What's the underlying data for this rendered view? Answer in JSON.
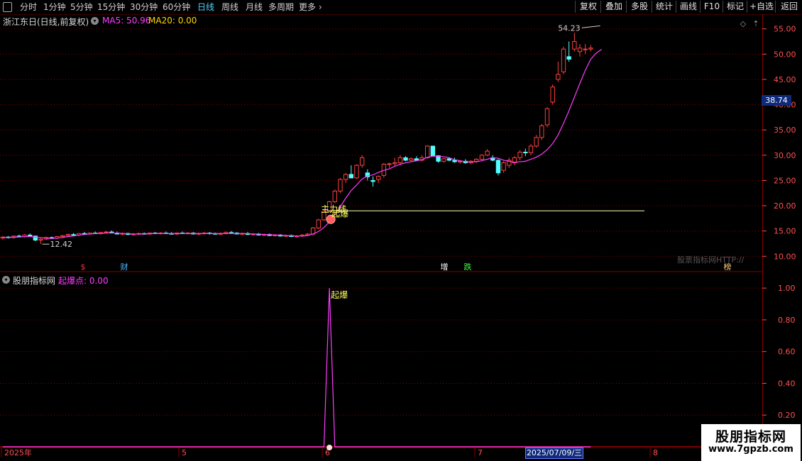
{
  "toolbar": {
    "left": [
      {
        "label": "分时",
        "active": false
      },
      {
        "label": "1分钟",
        "active": false
      },
      {
        "label": "5分钟",
        "active": false
      },
      {
        "label": "15分钟",
        "active": false
      },
      {
        "label": "30分钟",
        "active": false
      },
      {
        "label": "60分钟",
        "active": false
      },
      {
        "label": "日线",
        "active": true
      },
      {
        "label": "周线",
        "active": false
      },
      {
        "label": "月线",
        "active": false
      },
      {
        "label": "多周期",
        "active": false
      },
      {
        "label": "更多",
        "active": false
      }
    ],
    "more_arrow": "›",
    "right": [
      "复权",
      "叠加",
      "多股",
      "统计",
      "画线",
      "F10",
      "标记",
      "+自选",
      "返回"
    ]
  },
  "header": {
    "stock_name": "浙江东日(日线,前复权)",
    "ma5": "MA5: 50.96",
    "ma20": "MA20: 0.00"
  },
  "subchart": {
    "name": "股朋指标网",
    "value": "起爆点: 0.00"
  },
  "price_axis": [
    "55.00",
    "50.00",
    "45.00",
    "40.00",
    "35.00",
    "30.00",
    "25.00",
    "20.00",
    "15.00",
    "10.00"
  ],
  "price_tag": "38.74",
  "sub_axis": [
    "1.00",
    "0.80",
    "0.60",
    "0.40",
    "0.20"
  ],
  "date_axis": [
    "2025年",
    "5",
    "6",
    "7",
    "8"
  ],
  "date_tag": "2025/07/09/三",
  "annotations": {
    "high_label": "54.23",
    "low_label": "12.42",
    "signal_line_label": "主力线",
    "signal_marker_label": "起爆",
    "sub_peak_label": "起爆"
  },
  "event_markers": [
    {
      "label": "$",
      "color": "#ff3030"
    },
    {
      "label": "财",
      "color": "#4fb8ff"
    },
    {
      "label": "增",
      "color": "#ffffff"
    },
    {
      "label": "跌",
      "color": "#40ff40"
    },
    {
      "label": "榜",
      "color": "#ffd080"
    }
  ],
  "watermark": "股票指标网HTTP://",
  "brand": {
    "title": "股朋指标网",
    "url": "www.7gpzb.com"
  },
  "colors": {
    "up": "#ff4040",
    "down": "#54ffff",
    "ma5": "#ff3cff",
    "ma20": "#ffd800",
    "grid": "#8a0000",
    "axis_text": "#ff5050",
    "signal_line": "#ffffb0"
  },
  "chart_data": {
    "type": "candlestick",
    "price_range": [
      8.5,
      56.5
    ],
    "sub_range": [
      0,
      1.05
    ],
    "sessions": 140,
    "candles": [
      {
        "o": 13.6,
        "h": 14.0,
        "l": 13.3,
        "c": 13.8
      },
      {
        "o": 13.8,
        "h": 14.0,
        "l": 13.5,
        "c": 13.7
      },
      {
        "o": 13.7,
        "h": 14.1,
        "l": 13.5,
        "c": 14.0
      },
      {
        "o": 14.0,
        "h": 14.3,
        "l": 13.8,
        "c": 13.9
      },
      {
        "o": 13.9,
        "h": 14.4,
        "l": 13.7,
        "c": 14.2
      },
      {
        "o": 14.2,
        "h": 14.5,
        "l": 13.9,
        "c": 14.0
      },
      {
        "o": 14.0,
        "h": 14.1,
        "l": 13.0,
        "c": 13.2
      },
      {
        "o": 13.2,
        "h": 13.6,
        "l": 12.42,
        "c": 13.4
      },
      {
        "o": 13.4,
        "h": 13.9,
        "l": 13.2,
        "c": 13.7
      },
      {
        "o": 13.7,
        "h": 13.9,
        "l": 13.4,
        "c": 13.6
      },
      {
        "o": 13.6,
        "h": 14.0,
        "l": 13.4,
        "c": 13.9
      },
      {
        "o": 13.9,
        "h": 14.2,
        "l": 13.6,
        "c": 14.1
      },
      {
        "o": 14.1,
        "h": 14.5,
        "l": 13.9,
        "c": 14.3
      },
      {
        "o": 14.3,
        "h": 14.6,
        "l": 14.0,
        "c": 14.2
      },
      {
        "o": 14.2,
        "h": 14.6,
        "l": 14.0,
        "c": 14.5
      },
      {
        "o": 14.5,
        "h": 14.8,
        "l": 14.2,
        "c": 14.4
      },
      {
        "o": 14.4,
        "h": 14.7,
        "l": 14.2,
        "c": 14.6
      },
      {
        "o": 14.6,
        "h": 14.9,
        "l": 14.4,
        "c": 14.5
      },
      {
        "o": 14.5,
        "h": 14.8,
        "l": 14.3,
        "c": 14.7
      },
      {
        "o": 14.7,
        "h": 15.0,
        "l": 14.5,
        "c": 14.8
      },
      {
        "o": 14.8,
        "h": 15.1,
        "l": 14.5,
        "c": 14.6
      },
      {
        "o": 14.6,
        "h": 14.9,
        "l": 14.3,
        "c": 14.4
      },
      {
        "o": 14.4,
        "h": 14.7,
        "l": 14.2,
        "c": 14.5
      },
      {
        "o": 14.5,
        "h": 14.7,
        "l": 14.2,
        "c": 14.3
      },
      {
        "o": 14.3,
        "h": 14.6,
        "l": 14.1,
        "c": 14.4
      },
      {
        "o": 14.4,
        "h": 14.7,
        "l": 14.2,
        "c": 14.5
      },
      {
        "o": 14.5,
        "h": 14.7,
        "l": 14.3,
        "c": 14.4
      },
      {
        "o": 14.4,
        "h": 14.7,
        "l": 14.2,
        "c": 14.6
      },
      {
        "o": 14.6,
        "h": 14.8,
        "l": 14.4,
        "c": 14.5
      },
      {
        "o": 14.5,
        "h": 14.8,
        "l": 14.3,
        "c": 14.6
      },
      {
        "o": 14.6,
        "h": 14.9,
        "l": 14.4,
        "c": 14.5
      },
      {
        "o": 14.5,
        "h": 14.8,
        "l": 14.3,
        "c": 14.4
      },
      {
        "o": 14.4,
        "h": 14.7,
        "l": 14.2,
        "c": 14.6
      },
      {
        "o": 14.6,
        "h": 14.9,
        "l": 14.4,
        "c": 14.5
      },
      {
        "o": 14.5,
        "h": 14.8,
        "l": 14.3,
        "c": 14.6
      },
      {
        "o": 14.6,
        "h": 14.8,
        "l": 14.3,
        "c": 14.4
      },
      {
        "o": 14.4,
        "h": 14.7,
        "l": 14.2,
        "c": 14.5
      },
      {
        "o": 14.5,
        "h": 14.8,
        "l": 14.3,
        "c": 14.6
      },
      {
        "o": 14.6,
        "h": 14.8,
        "l": 14.3,
        "c": 14.5
      },
      {
        "o": 14.5,
        "h": 14.7,
        "l": 14.3,
        "c": 14.4
      },
      {
        "o": 14.4,
        "h": 14.7,
        "l": 14.2,
        "c": 14.5
      },
      {
        "o": 14.5,
        "h": 14.9,
        "l": 14.3,
        "c": 14.7
      },
      {
        "o": 14.7,
        "h": 15.0,
        "l": 14.4,
        "c": 14.6
      },
      {
        "o": 14.6,
        "h": 14.8,
        "l": 14.3,
        "c": 14.4
      },
      {
        "o": 14.4,
        "h": 14.7,
        "l": 14.2,
        "c": 14.5
      },
      {
        "o": 14.5,
        "h": 14.8,
        "l": 14.2,
        "c": 14.3
      },
      {
        "o": 14.3,
        "h": 14.6,
        "l": 14.1,
        "c": 14.4
      },
      {
        "o": 14.4,
        "h": 14.6,
        "l": 14.1,
        "c": 14.2
      },
      {
        "o": 14.2,
        "h": 14.5,
        "l": 14.0,
        "c": 14.3
      },
      {
        "o": 14.3,
        "h": 14.5,
        "l": 14.0,
        "c": 14.1
      },
      {
        "o": 14.1,
        "h": 14.4,
        "l": 13.9,
        "c": 14.2
      },
      {
        "o": 14.2,
        "h": 14.4,
        "l": 13.9,
        "c": 14.0
      },
      {
        "o": 14.0,
        "h": 14.3,
        "l": 13.8,
        "c": 14.1
      },
      {
        "o": 14.1,
        "h": 14.3,
        "l": 13.8,
        "c": 13.9
      },
      {
        "o": 13.9,
        "h": 14.2,
        "l": 13.7,
        "c": 14.0
      },
      {
        "o": 14.0,
        "h": 14.4,
        "l": 13.8,
        "c": 14.2
      },
      {
        "o": 14.2,
        "h": 14.6,
        "l": 14.0,
        "c": 14.4
      },
      {
        "o": 14.4,
        "h": 15.8,
        "l": 14.2,
        "c": 15.6
      },
      {
        "o": 15.6,
        "h": 17.4,
        "l": 15.4,
        "c": 17.2
      },
      {
        "o": 17.2,
        "h": 19.2,
        "l": 17.0,
        "c": 18.9
      },
      {
        "o": 18.9,
        "h": 21.0,
        "l": 18.8,
        "c": 20.8
      },
      {
        "o": 20.8,
        "h": 23.2,
        "l": 20.5,
        "c": 22.9
      },
      {
        "o": 22.9,
        "h": 25.5,
        "l": 22.5,
        "c": 25.2
      },
      {
        "o": 25.2,
        "h": 26.5,
        "l": 24.5,
        "c": 26.2
      },
      {
        "o": 26.2,
        "h": 28.0,
        "l": 25.5,
        "c": 25.5
      },
      {
        "o": 25.5,
        "h": 28.2,
        "l": 25.3,
        "c": 28.0
      },
      {
        "o": 28.0,
        "h": 30.0,
        "l": 27.5,
        "c": 29.5
      },
      {
        "o": 26.5,
        "h": 27.2,
        "l": 25.0,
        "c": 25.7
      },
      {
        "o": 25.0,
        "h": 25.8,
        "l": 23.8,
        "c": 24.8
      },
      {
        "o": 25.2,
        "h": 26.0,
        "l": 24.5,
        "c": 25.8
      },
      {
        "o": 26.0,
        "h": 28.5,
        "l": 25.5,
        "c": 28.2
      },
      {
        "o": 28.2,
        "h": 28.5,
        "l": 27.5,
        "c": 28.3
      },
      {
        "o": 28.3,
        "h": 29.5,
        "l": 27.8,
        "c": 28.5
      },
      {
        "o": 28.5,
        "h": 30.0,
        "l": 28.0,
        "c": 29.5
      },
      {
        "o": 29.5,
        "h": 29.8,
        "l": 28.8,
        "c": 29.0
      },
      {
        "o": 29.0,
        "h": 29.6,
        "l": 28.6,
        "c": 29.3
      },
      {
        "o": 29.3,
        "h": 29.8,
        "l": 28.8,
        "c": 29.0
      },
      {
        "o": 29.0,
        "h": 30.0,
        "l": 28.8,
        "c": 29.5
      },
      {
        "o": 29.5,
        "h": 32.0,
        "l": 29.3,
        "c": 31.8
      },
      {
        "o": 31.8,
        "h": 31.8,
        "l": 29.8,
        "c": 29.9
      },
      {
        "o": 29.9,
        "h": 30.0,
        "l": 28.5,
        "c": 28.8
      },
      {
        "o": 28.8,
        "h": 29.5,
        "l": 28.5,
        "c": 29.3
      },
      {
        "o": 29.3,
        "h": 29.6,
        "l": 28.8,
        "c": 29.0
      },
      {
        "o": 29.0,
        "h": 29.5,
        "l": 28.5,
        "c": 28.7
      },
      {
        "o": 28.7,
        "h": 29.0,
        "l": 28.3,
        "c": 28.8
      },
      {
        "o": 28.8,
        "h": 29.2,
        "l": 28.3,
        "c": 28.5
      },
      {
        "o": 28.5,
        "h": 29.0,
        "l": 28.2,
        "c": 28.8
      },
      {
        "o": 28.8,
        "h": 29.4,
        "l": 28.5,
        "c": 29.2
      },
      {
        "o": 29.2,
        "h": 30.2,
        "l": 29.0,
        "c": 30.0
      },
      {
        "o": 30.0,
        "h": 31.2,
        "l": 29.8,
        "c": 30.8
      },
      {
        "o": 29.5,
        "h": 30.0,
        "l": 28.8,
        "c": 29.0
      },
      {
        "o": 29.0,
        "h": 29.2,
        "l": 26.0,
        "c": 26.5
      },
      {
        "o": 27.0,
        "h": 28.8,
        "l": 26.5,
        "c": 28.5
      },
      {
        "o": 28.0,
        "h": 29.5,
        "l": 27.5,
        "c": 29.0
      },
      {
        "o": 28.5,
        "h": 29.8,
        "l": 28.0,
        "c": 29.5
      },
      {
        "o": 29.5,
        "h": 31.0,
        "l": 29.0,
        "c": 30.6
      },
      {
        "o": 30.6,
        "h": 31.3,
        "l": 29.8,
        "c": 30.5
      },
      {
        "o": 30.5,
        "h": 32.2,
        "l": 30.0,
        "c": 31.8
      },
      {
        "o": 31.8,
        "h": 34.0,
        "l": 31.5,
        "c": 33.5
      },
      {
        "o": 33.5,
        "h": 36.2,
        "l": 33.0,
        "c": 35.8
      },
      {
        "o": 36.0,
        "h": 39.5,
        "l": 35.5,
        "c": 39.2
      },
      {
        "o": 40.5,
        "h": 44.0,
        "l": 40.0,
        "c": 43.5
      },
      {
        "o": 45.0,
        "h": 48.5,
        "l": 44.5,
        "c": 46.0
      },
      {
        "o": 46.5,
        "h": 51.5,
        "l": 46.0,
        "c": 51.0
      },
      {
        "o": 49.5,
        "h": 52.5,
        "l": 48.5,
        "c": 49.0
      },
      {
        "o": 51.0,
        "h": 54.23,
        "l": 50.5,
        "c": 52.5
      },
      {
        "o": 50.5,
        "h": 52.0,
        "l": 49.5,
        "c": 51.2
      },
      {
        "o": 51.0,
        "h": 52.0,
        "l": 50.0,
        "c": 51.0
      },
      {
        "o": 51.0,
        "h": 51.8,
        "l": 50.5,
        "c": 51.2
      }
    ],
    "ma5": [
      13.7,
      13.7,
      13.8,
      13.8,
      13.9,
      13.9,
      13.8,
      13.7,
      13.6,
      13.5,
      13.6,
      13.7,
      13.9,
      14.0,
      14.2,
      14.3,
      14.4,
      14.5,
      14.5,
      14.6,
      14.6,
      14.6,
      14.5,
      14.5,
      14.4,
      14.4,
      14.4,
      14.5,
      14.5,
      14.5,
      14.5,
      14.5,
      14.5,
      14.5,
      14.5,
      14.5,
      14.5,
      14.5,
      14.5,
      14.5,
      14.5,
      14.5,
      14.5,
      14.5,
      14.5,
      14.5,
      14.4,
      14.4,
      14.3,
      14.3,
      14.2,
      14.2,
      14.1,
      14.1,
      14.0,
      14.0,
      14.1,
      14.4,
      14.9,
      15.7,
      16.8,
      18.2,
      19.8,
      21.5,
      23.0,
      24.1,
      25.3,
      25.9,
      26.1,
      26.6,
      27.0,
      27.3,
      27.8,
      28.2,
      28.5,
      28.7,
      28.9,
      29.1,
      29.6,
      29.8,
      29.8,
      29.7,
      29.5,
      29.1,
      28.9,
      28.7,
      28.7,
      28.7,
      28.9,
      29.2,
      29.5,
      29.4,
      29.0,
      28.8,
      28.6,
      28.7,
      28.8,
      29.2,
      29.6,
      30.2,
      31.1,
      32.3,
      34.0,
      36.3,
      38.8,
      41.5,
      44.2,
      46.8,
      49.0,
      50.2,
      50.96
    ]
  }
}
